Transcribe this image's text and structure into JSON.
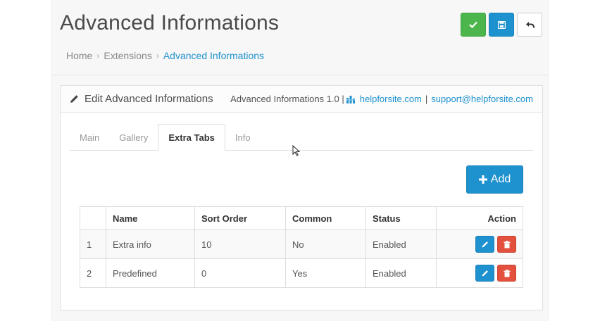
{
  "header": {
    "title": "Advanced Informations",
    "breadcrumb": [
      "Home",
      "Extensions",
      "Advanced Informations"
    ],
    "buttons": {
      "save_stay_icon": "check-icon",
      "save_icon": "floppy-icon",
      "back_icon": "reply-icon"
    }
  },
  "panel": {
    "title": "Edit Advanced Informations",
    "version": "Advanced Informations 1.0 |",
    "site_link": "helpforsite.com",
    "separator": "|",
    "email_link": "support@helpforsite.com"
  },
  "tabs": [
    {
      "label": "Main",
      "active": false
    },
    {
      "label": "Gallery",
      "active": false
    },
    {
      "label": "Extra Tabs",
      "active": true
    },
    {
      "label": "Info",
      "active": false
    }
  ],
  "add_button": "Add",
  "table": {
    "headers": [
      "",
      "Name",
      "Sort Order",
      "Common",
      "Status",
      "Action"
    ],
    "rows": [
      {
        "num": "1",
        "name": "Extra info",
        "sort": "10",
        "common": "No",
        "status": "Enabled"
      },
      {
        "num": "2",
        "name": "Predefined",
        "sort": "0",
        "common": "Yes",
        "status": "Enabled"
      }
    ]
  },
  "colors": {
    "primary": "#1e91cf",
    "success": "#4cb64c",
    "danger": "#e3503e"
  }
}
